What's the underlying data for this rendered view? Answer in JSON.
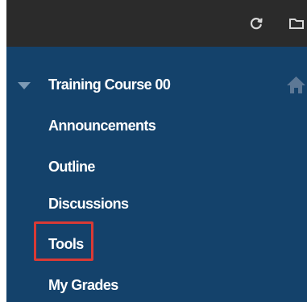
{
  "toolbar": {
    "icons": [
      "refresh-icon",
      "folder-icon"
    ]
  },
  "course_menu": {
    "title": "Training Course 00",
    "home_icon": "home-icon",
    "items": [
      {
        "label": "Announcements"
      },
      {
        "label": "Outline"
      },
      {
        "label": "Discussions"
      },
      {
        "label": "Tools",
        "highlighted": true
      },
      {
        "label": "My Grades"
      }
    ]
  },
  "colors": {
    "toolbar_background": "#2b2b2b",
    "menu_background": "#14426b",
    "menu_text": "#ffffff",
    "highlight_border": "#d93a35",
    "caret": "#7d9ab5"
  }
}
